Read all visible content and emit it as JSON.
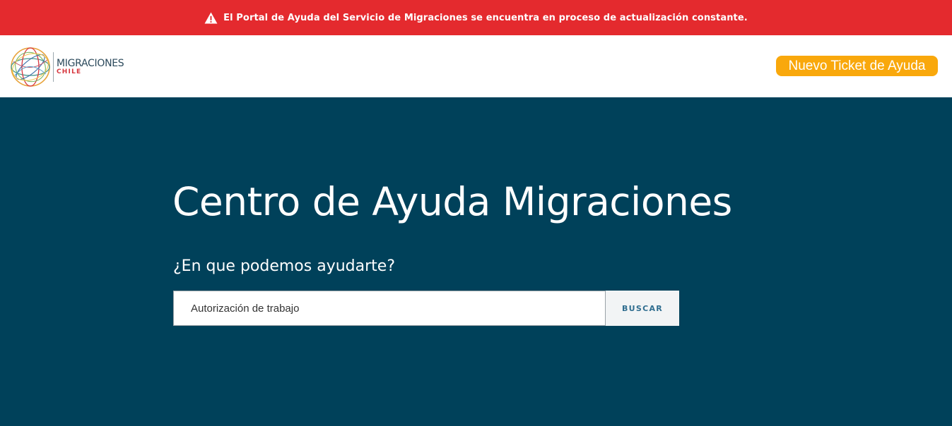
{
  "alert": {
    "icon": "warning-icon",
    "message": "El Portal de Ayuda del Servicio de Migraciones se encuentra en proceso de actualización constante.",
    "background_color": "#e42a2e"
  },
  "header": {
    "logo": {
      "main": "MIGRACIONES",
      "sub": "CHILE"
    },
    "ticket_button_label": "Nuevo Ticket de Ayuda",
    "ticket_button_color": "#f9a80c"
  },
  "hero": {
    "background_color": "#00415a",
    "title": "Centro de Ayuda Migraciones",
    "subtitle": "¿En que podemos ayudarte?",
    "search": {
      "value": "Autorización de trabajo",
      "placeholder": "",
      "button_label": "BUSCAR"
    }
  }
}
